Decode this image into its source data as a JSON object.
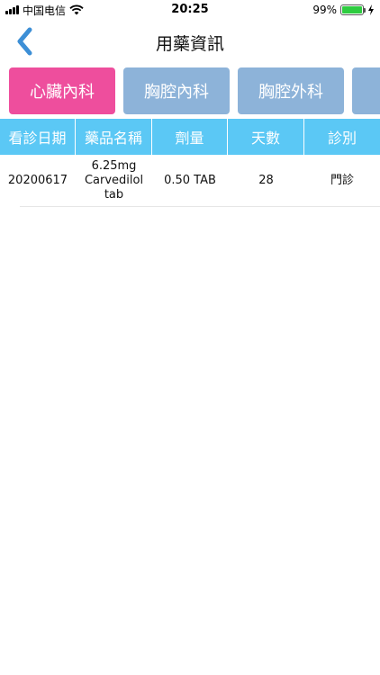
{
  "status_bar": {
    "carrier": "中国电信",
    "time": "20:25",
    "battery_percent": "99%",
    "battery_level": 0.99,
    "signal_icon": "signal-bars-icon",
    "wifi_icon": "wifi-icon",
    "charging_icon": "bolt-icon"
  },
  "nav": {
    "title": "用藥資訊",
    "back_icon": "chevron-left-icon"
  },
  "tabs": [
    {
      "label": "心臟內科",
      "selected": true
    },
    {
      "label": "胸腔內科",
      "selected": false
    },
    {
      "label": "胸腔外科",
      "selected": false
    },
    {
      "label": "",
      "selected": false
    }
  ],
  "table": {
    "headers": [
      "看診日期",
      "藥品名稱",
      "劑量",
      "天數",
      "診別"
    ],
    "rows": [
      {
        "date": "20200617",
        "drug": "6.25mg Carvedilol tab",
        "dose": "0.50 TAB",
        "days": "28",
        "type": "門診"
      }
    ]
  },
  "colors": {
    "tab_selected": "#ee4e9d",
    "tab_default": "#8db3d9",
    "header_bg": "#5bc8f5",
    "back_arrow": "#3d8fd6",
    "battery": "#2ecc40"
  }
}
